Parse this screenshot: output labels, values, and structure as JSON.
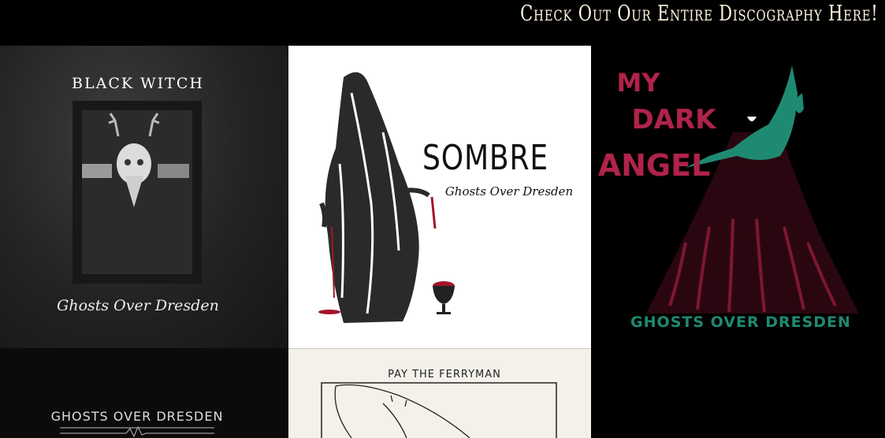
{
  "header": {
    "link_label": "Check Out Our Entire Discography Here!"
  },
  "albums": [
    {
      "title": "BLACK WITCH",
      "artist": "Ghosts Over Dresden"
    },
    {
      "title": "SOMBRE",
      "artist": "Ghosts Over Dresden"
    },
    {
      "title_line1": "MY",
      "title_line2": "DARK",
      "title_line3": "ANGEL",
      "artist": "GHOSTS OVER DRESDEN"
    },
    {
      "artist": "GHOSTS OVER DRESDEN"
    },
    {
      "title": "PAY THE FERRYMAN"
    }
  ],
  "colors": {
    "header_text": "#fff5df",
    "angel_title": "#b0234a",
    "angel_figure": "#1f8a72",
    "blood": "#a3152b"
  }
}
